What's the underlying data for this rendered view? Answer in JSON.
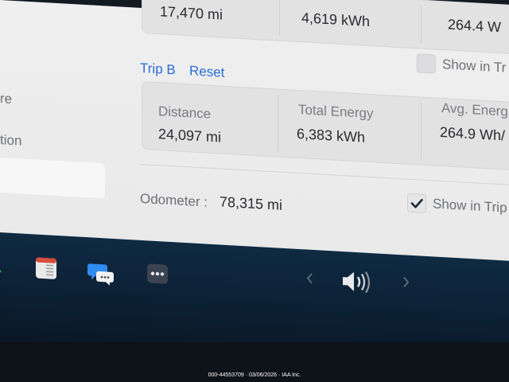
{
  "trip_a": {
    "distance": "17,470 mi",
    "total_energy": "4,619 kWh",
    "avg_energy": "264.4 W"
  },
  "trip_b": {
    "tab_label": "Trip B",
    "reset_label": "Reset",
    "show_in_trip_label": "Show in Tr",
    "distance_label": "Distance",
    "distance_value": "24,097 mi",
    "total_energy_label": "Total Energy",
    "total_energy_value": "6,383 kWh",
    "avg_energy_label": "Avg. Energ",
    "avg_energy_value": "264.9 Wh/"
  },
  "left_panel": {
    "item1": "re",
    "item2": "tion"
  },
  "odometer": {
    "label": "Odometer :",
    "value": "78,315 mi",
    "show_in_trip_label": "Show in Trip",
    "show_in_trip_checked": true
  },
  "taskbar": {
    "icons": [
      "phone-icon",
      "calendar-icon",
      "messages-icon",
      "more-apps-icon",
      "chevron-left-icon",
      "volume-icon",
      "chevron-right-icon"
    ]
  },
  "watermark": "000-44553709 · 03/06/2026 · IAA Inc."
}
